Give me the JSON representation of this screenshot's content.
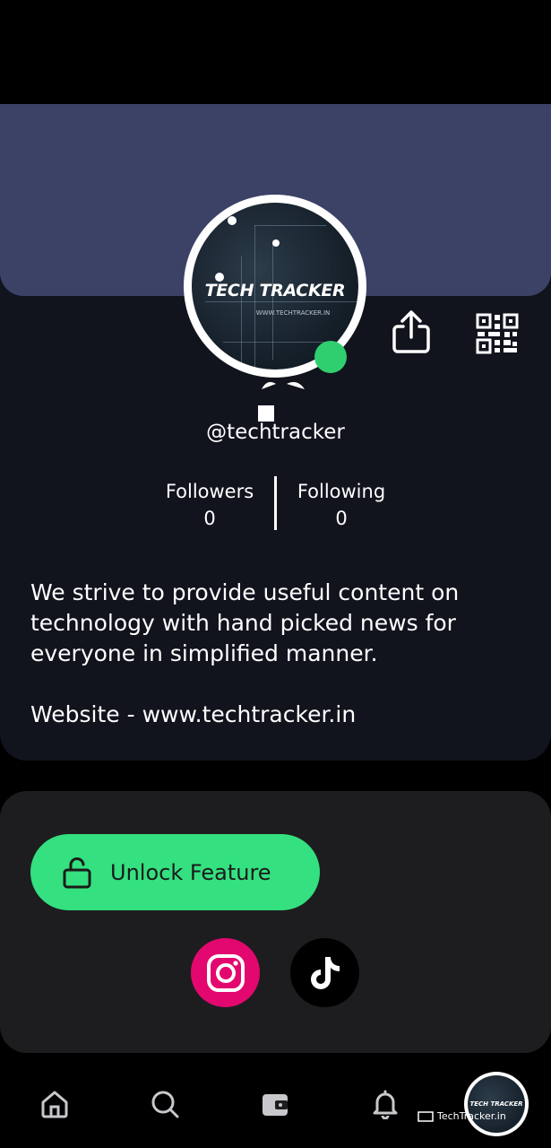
{
  "profile": {
    "avatar_brand": "TECH TRACKER",
    "avatar_url": "WWW.TECHTRACKER.IN",
    "handle": "@techtracker",
    "followers_label": "Followers",
    "followers_count": "0",
    "following_label": "Following",
    "following_count": "0",
    "bio": "We strive to provide useful content on technology with hand picked news for everyone in simplified manner.\n\nWebsite - www.techtracker.in",
    "online_color": "#2fcf6f"
  },
  "actions": {
    "unlock_label": "Unlock Feature",
    "unlock_icon": "unlock-icon",
    "socials": [
      {
        "name": "instagram",
        "icon": "instagram-icon",
        "color": "#e3086f"
      },
      {
        "name": "tiktok",
        "icon": "tiktok-icon",
        "color": "#000000"
      }
    ]
  },
  "header_actions": {
    "share_icon": "share-icon",
    "qr_icon": "qr-code-icon"
  },
  "bottom_nav": {
    "items": [
      "home-icon",
      "search-icon",
      "wallet-icon",
      "bell-icon",
      "profile-avatar"
    ],
    "profile_brand": "TECH TRACKER"
  },
  "watermark": {
    "text": "TechTracker.in"
  },
  "colors": {
    "cover": "#3b4266",
    "card": "#11131d",
    "accent": "#34e07f"
  }
}
